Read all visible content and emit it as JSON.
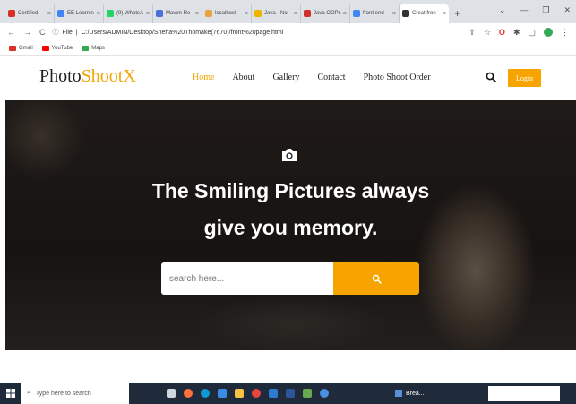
{
  "browser": {
    "tabs": [
      {
        "title": "Certified",
        "color": "#d93025"
      },
      {
        "title": "EE Learnin",
        "color": "#4285f4"
      },
      {
        "title": "(9) WhatsA",
        "color": "#25d366"
      },
      {
        "title": "Maven Re",
        "color": "#4a6fd8"
      },
      {
        "title": "localhost",
        "color": "#e8a33c"
      },
      {
        "title": "Java - No",
        "color": "#f0b400"
      },
      {
        "title": "Java OOPs",
        "color": "#d32f2f"
      },
      {
        "title": "front end",
        "color": "#4285f4"
      },
      {
        "title": "Creat fron",
        "color": "#333333"
      }
    ],
    "new_tab": "+",
    "url_prefix": "File",
    "url": "C:/Users/ADMIN/Desktop/Sneha%20Thomake(7670)/front%20page.html",
    "bookmarks": [
      {
        "label": "Gmail",
        "color": "#d93025"
      },
      {
        "label": "YouTube",
        "color": "#ff0000"
      },
      {
        "label": "Maps",
        "color": "#34a853"
      }
    ]
  },
  "site": {
    "logo_main": "Photo",
    "logo_accent": "ShootX",
    "nav": [
      "Home",
      "About",
      "Gallery",
      "Contact",
      "Photo Shoot Order"
    ],
    "login": "Login"
  },
  "hero": {
    "line1": "The Smiling Pictures always",
    "line2": "give you memory.",
    "search_placeholder": "search here..."
  },
  "taskbar": {
    "search_placeholder": "Type here to search",
    "running_label": "Brea..."
  },
  "colors": {
    "accent": "#f7a400",
    "taskbar": "#1f2b3a"
  }
}
